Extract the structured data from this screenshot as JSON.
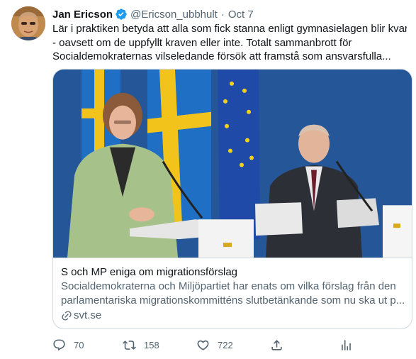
{
  "tweet": {
    "author_name": "Jan Ericson",
    "handle": "@Ericson_ubbhult",
    "separator": "·",
    "time": "Oct 7",
    "text_lines": [
      "Lär i praktiken betyda att alla som fick stanna enligt gymnasielagen blir kvar",
      "- oavsett om de uppfyllt kraven eller inte. Totalt sammanbrott för",
      "Socialdemokraternas vilseledande försök att framstå som ansvarsfulla..."
    ]
  },
  "card": {
    "title": "S och MP eniga om migrationsförslag",
    "description_lines": [
      "Socialdemokraterna och Miljöpartiet har enats om vilka förslag från den",
      "parlamentariska migrationskommitténs slutbetänkande som nu ska ut p..."
    ],
    "domain": "svt.se"
  },
  "actions": {
    "reply_count": "70",
    "retweet_count": "158",
    "like_count": "722"
  },
  "icons": {
    "verified": "verified-badge-icon",
    "link": "link-icon",
    "reply": "reply-icon",
    "retweet": "retweet-icon",
    "like": "heart-icon",
    "share": "share-icon",
    "analytics": "analytics-icon"
  },
  "colors": {
    "accent": "#1d9bf0",
    "text": "#0f1419",
    "secondary": "#536471",
    "border": "#cfd9de"
  }
}
